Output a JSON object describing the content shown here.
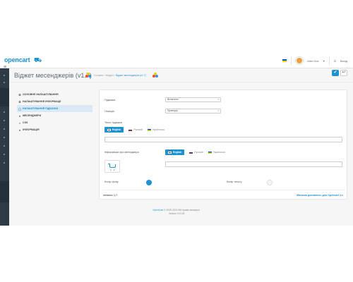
{
  "header": {
    "logo_text": "opencart",
    "user_name": "John Doe",
    "logout_label": "Вихід"
  },
  "page": {
    "title": "Віджет месенджерів (v1.7)",
    "breadcrumb": [
      "Головна",
      "Модулі",
      "Віджет месенджерів (v1.7)"
    ],
    "save_icon": "check-icon",
    "back_icon": "reply-icon"
  },
  "tabs": [
    {
      "label": "ОСНОВНЕ НАЛАШТУВАННЯ",
      "icon": "gear-icon",
      "active": false
    },
    {
      "label": "НАЛАШТУВАННЯ ІНФОРМАЦІЇ",
      "icon": "gear-icon",
      "active": false
    },
    {
      "label": "НАЛАШТУВАННЯ ПІДКАЗКИ",
      "icon": "comment-icon",
      "active": true
    },
    {
      "label": "МЕСЕНДЖЕРИ",
      "icon": "chat-icon",
      "active": false
    },
    {
      "label": "CSS",
      "icon": "code-icon",
      "active": false
    },
    {
      "label": "ІНФОРМАЦІЯ",
      "icon": "info-icon",
      "active": false
    }
  ],
  "form": {
    "tooltip_label": "Підказка",
    "tooltip_value": "Включено",
    "position_label": "Позиція",
    "position_value": "Праворуч",
    "tooltip_text_label": "Текст підказки",
    "manager_info_label": "Інформація про менеджера",
    "background_color_label": "Колір фону",
    "text_color_label": "Колір тексту",
    "languages": [
      "English",
      "Русский",
      "Українська"
    ]
  },
  "panel_footer": {
    "version_label": "version:",
    "version_value": "1.7",
    "addons_link": "Магазин доповнень для Opencart 3.x"
  },
  "footer": {
    "line1_link": "OpenCart",
    "line1_text": "© 2009-2024 Всі права захищені.",
    "line2": "Version 3.0.3.8"
  },
  "colors": {
    "accent": "#1e91cf",
    "sidebar": "#2e3a45"
  }
}
